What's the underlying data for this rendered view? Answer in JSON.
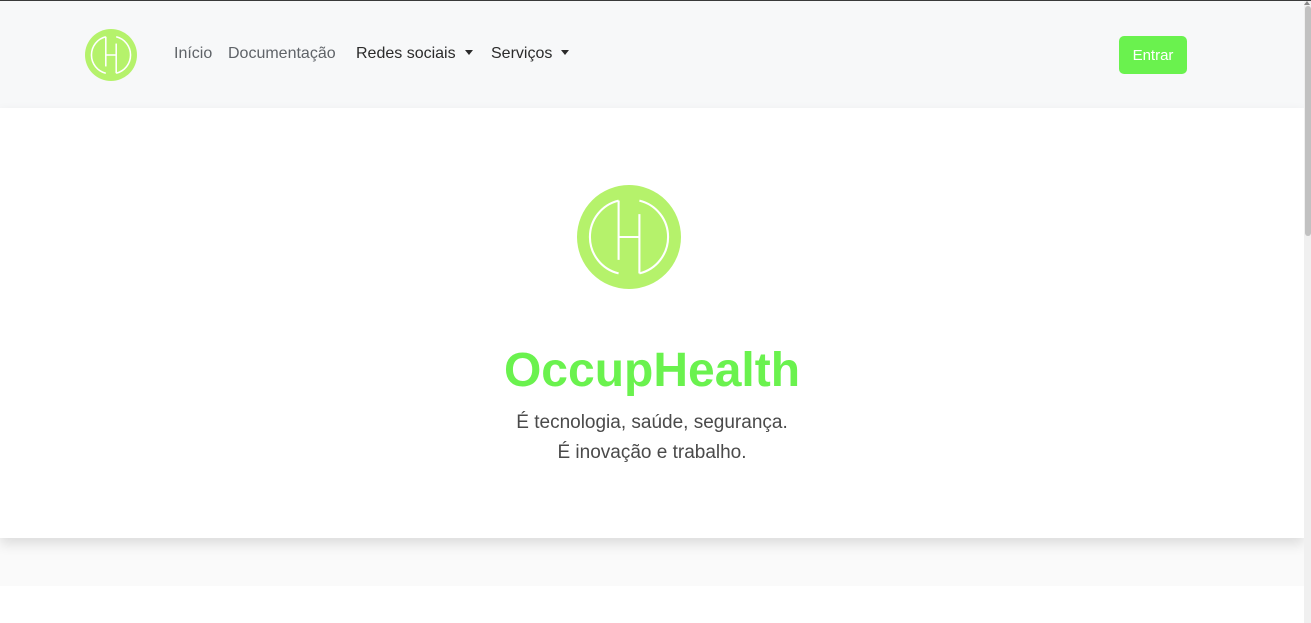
{
  "brand": {
    "color": "#6af24e",
    "logo_color": "#b5f26b",
    "logo_icon": "occuphealth-logo-icon"
  },
  "navbar": {
    "links": [
      {
        "label": "Início"
      },
      {
        "label": "Documentação"
      },
      {
        "label": "Redes sociais",
        "dropdown": true
      },
      {
        "label": "Serviços",
        "dropdown": true
      }
    ],
    "login_label": "Entrar"
  },
  "hero": {
    "title": "OccupHealth",
    "subtitle_line1": "É tecnologia, saúde, segurança.",
    "subtitle_line2": "É inovação e trabalho."
  }
}
